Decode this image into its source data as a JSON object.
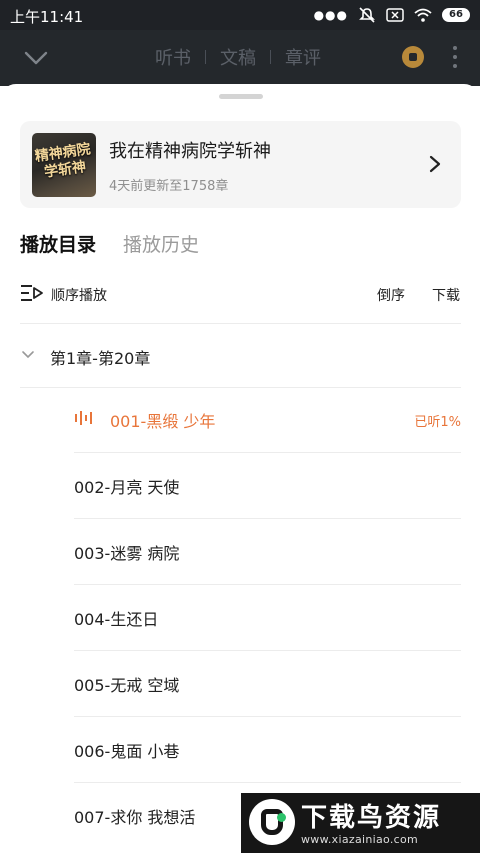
{
  "status_bar": {
    "time": "上午11:41",
    "battery": "66",
    "icons": [
      "more-dots-icon",
      "mute-icon",
      "sim-x-icon",
      "wifi-icon",
      "battery-icon"
    ]
  },
  "top_bar": {
    "tabs": [
      "听书",
      "文稿",
      "章评"
    ],
    "icons": [
      "chevron-down-icon",
      "coin-icon",
      "more-vertical-icon"
    ]
  },
  "book": {
    "cover_text": "精神病院学斩神",
    "title": "我在精神病院学斩神",
    "subtitle": "4天前更新至1758章"
  },
  "tabs": {
    "catalog": "播放目录",
    "history": "播放历史"
  },
  "controls": {
    "order_label": "顺序播放",
    "reverse_label": "倒序",
    "download_label": "下载"
  },
  "group": {
    "label": "第1章-第20章"
  },
  "chapters": [
    {
      "title": "001-黑缎 少年",
      "progress": "已听1%",
      "playing": true
    },
    {
      "title": "002-月亮 天使"
    },
    {
      "title": "003-迷雾 病院"
    },
    {
      "title": "004-生还日"
    },
    {
      "title": "005-无戒 空域"
    },
    {
      "title": "006-鬼面 小巷"
    },
    {
      "title": "007-求你 我想活"
    }
  ],
  "watermark": {
    "name": "下载鸟资源",
    "url": "www.xiazainiao.com"
  },
  "colors": {
    "accent": "#e8753a",
    "topbar": "#24282c",
    "statusbar": "#1f2226"
  }
}
